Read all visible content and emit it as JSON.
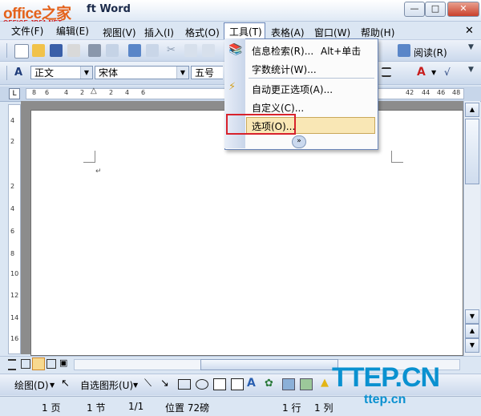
{
  "title": {
    "logo_main": "office之家",
    "logo_sub": "OFFICE.JB51.NET",
    "text": "ft Word"
  },
  "menubar": {
    "items": [
      "文件(F)",
      "编辑(E)",
      "视图(V)",
      "插入(I)",
      "格式(O)",
      "工具(T)",
      "表格(A)",
      "窗口(W)",
      "帮助(H)"
    ]
  },
  "toolbar": {
    "style": "正文",
    "font": "宋体",
    "size": "五号",
    "read": "阅读(R)"
  },
  "ruler": {
    "numbers": [
      "8",
      "6",
      "4",
      "2",
      "2",
      "4",
      "6",
      "42",
      "44",
      "46",
      "48"
    ]
  },
  "vruler": {
    "numbers": [
      "4",
      "2",
      "2",
      "4",
      "6",
      "8",
      "10",
      "12",
      "14",
      "16"
    ]
  },
  "tools_menu": {
    "research": "信息检索(R)...",
    "research_shortcut": "Alt+单击",
    "word_count": "字数统计(W)...",
    "autocorrect": "自动更正选项(A)...",
    "customize": "自定义(C)...",
    "options": "选项(O)..."
  },
  "drawbar": {
    "draw": "绘图(D)",
    "autoshapes": "自选图形(U)"
  },
  "status": {
    "page": "1 页",
    "section": "1 节",
    "pages": "1/1",
    "position": "位置 72磅",
    "line": "1 行",
    "column": "1 列"
  },
  "watermark": {
    "brand": "TTEP.CN",
    "url": "ttep.cn"
  },
  "colors": {
    "highlight_border": "#d8222c",
    "menu_hover": "#f9e7b5",
    "watermark": "#0a91d0",
    "logo": "#e4621b"
  }
}
